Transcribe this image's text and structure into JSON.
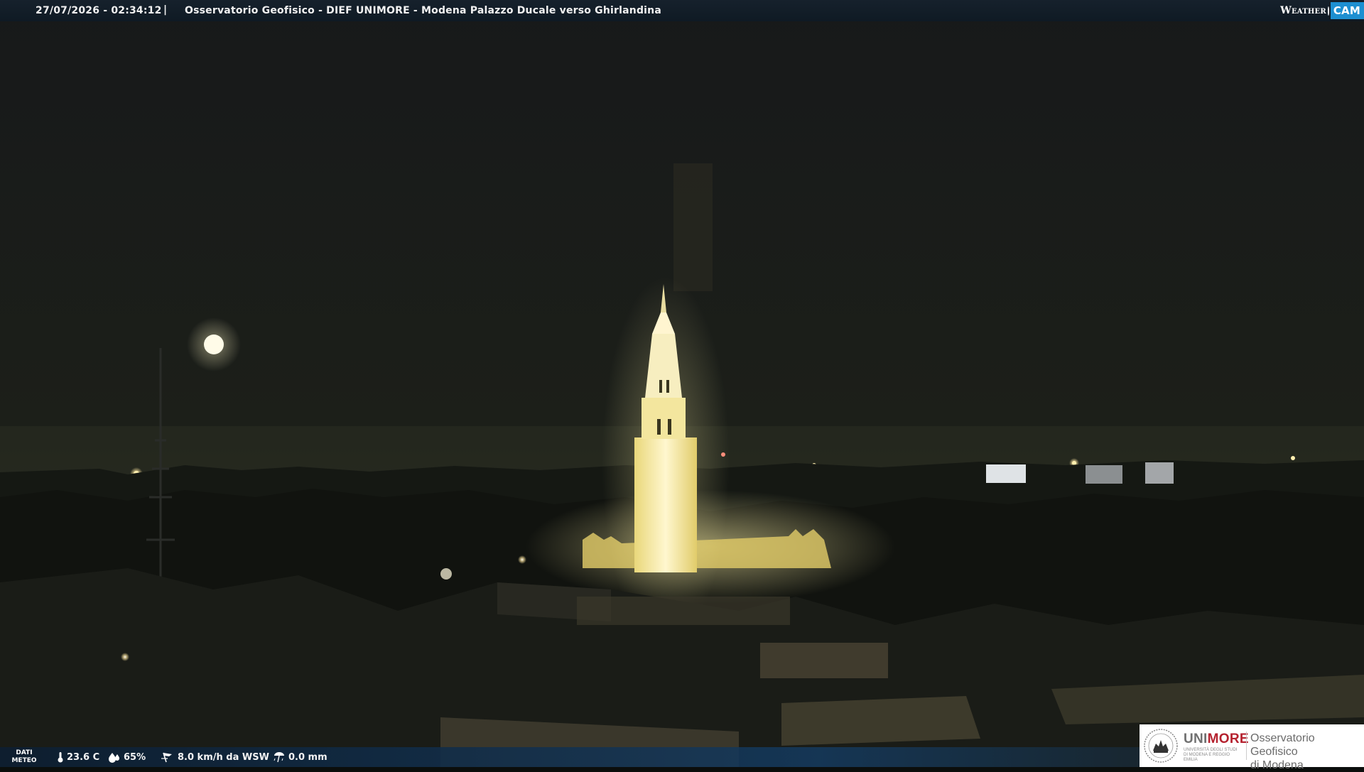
{
  "header": {
    "datetime": "27/07/2026 - 02:34:12",
    "separator": "|",
    "title": "Osservatorio Geofisico - DIEF UNIMORE - Modena Palazzo Ducale verso Ghirlandina",
    "logo_weather": "Weather",
    "logo_cam": "CAM"
  },
  "footer": {
    "dati_label_line1": "DATI",
    "dati_label_line2": "METEO",
    "temperature": "23.6 C",
    "humidity": "65%",
    "wind": "8.0 km/h da WSW",
    "rain": "0.0 mm",
    "icons": [
      "thermometer-icon",
      "humidity-drop-icon",
      "wind-icon",
      "rain-gauge-icon"
    ]
  },
  "badge": {
    "brand_uni": "UNI",
    "brand_more": "MORE",
    "brand_sub": "UNIVERSITÀ DEGLI STUDI DI MODENA E REGGIO EMILIA",
    "obs_line1": "Osservatorio Geofisico",
    "obs_line2": "di Modena"
  },
  "colors": {
    "top_bar": "#0f1a24",
    "bottom_bar": "#143a5f",
    "cam_blue": "#1d8fd1",
    "unimore_red": "#b5222f",
    "sky": "#191c17",
    "tower_light": "#fff6c2"
  }
}
